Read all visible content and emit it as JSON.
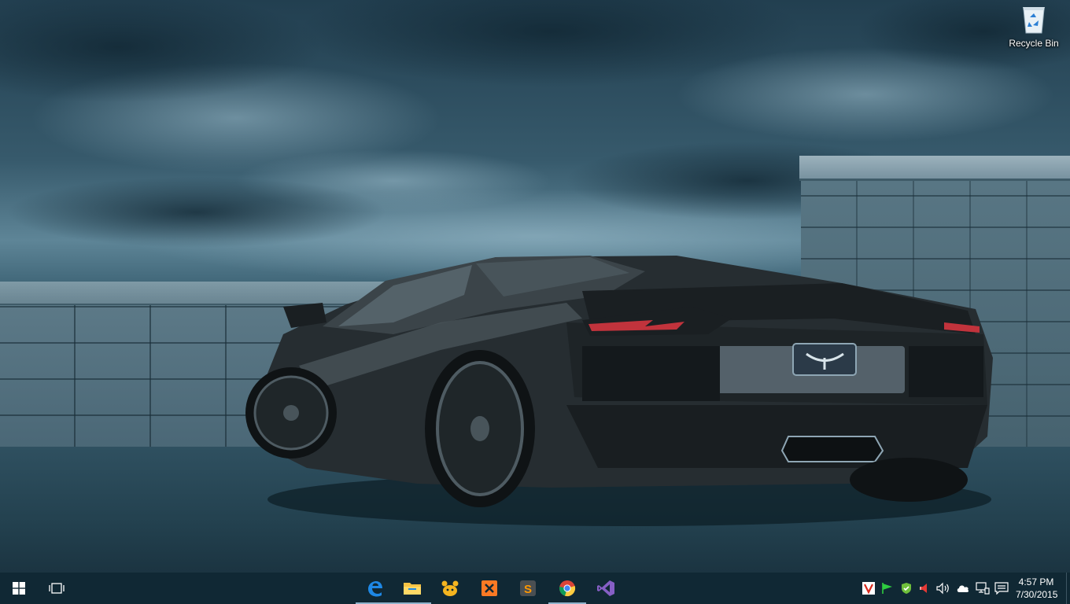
{
  "desktop": {
    "icons": [
      {
        "label": "Recycle Bin",
        "icon": "recycle-bin-icon"
      }
    ]
  },
  "taskbar": {
    "start": {
      "icon": "windows-logo-icon"
    },
    "task_view": {
      "icon": "task-view-icon"
    },
    "pinned": [
      {
        "name": "Microsoft Edge",
        "icon": "edge-icon",
        "active": true,
        "color": "#1e88e5"
      },
      {
        "name": "File Explorer",
        "icon": "folder-icon",
        "active": true,
        "color": "#f6c344"
      },
      {
        "name": "Paw app",
        "icon": "paw-icon",
        "active": false,
        "color": "#f5b51f"
      },
      {
        "name": "XAMPP",
        "icon": "xampp-icon",
        "active": false,
        "color": "#fb7a24"
      },
      {
        "name": "Sublime Text",
        "icon": "sublime-text-icon",
        "active": false,
        "color": "#ff9800"
      },
      {
        "name": "Google Chrome",
        "icon": "chrome-icon",
        "active": true,
        "color": "#4caf50"
      },
      {
        "name": "Visual Studio",
        "icon": "visual-studio-icon",
        "active": false,
        "color": "#865fc5"
      }
    ],
    "tray": [
      {
        "icon": "vivaldi-icon"
      },
      {
        "icon": "green-flag-icon"
      },
      {
        "icon": "security-shield-icon"
      },
      {
        "icon": "red-speaker-icon"
      },
      {
        "icon": "volume-icon"
      },
      {
        "icon": "onedrive-cloud-icon"
      },
      {
        "icon": "network-icon"
      },
      {
        "icon": "action-center-icon"
      }
    ],
    "clock": {
      "time": "4:57 PM",
      "date": "7/30/2015"
    }
  }
}
